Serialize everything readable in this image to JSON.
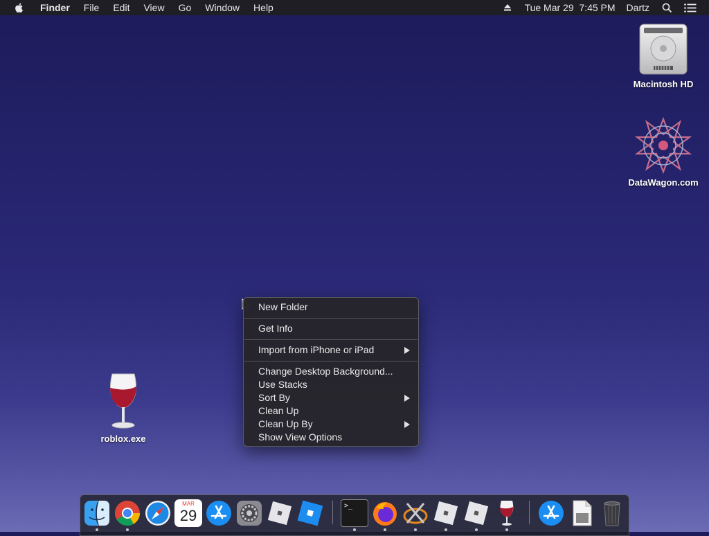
{
  "menubar": {
    "app": "Finder",
    "menus": [
      "File",
      "Edit",
      "View",
      "Go",
      "Window",
      "Help"
    ],
    "datetime": "Tue Mar 29  7:45 PM",
    "user": "Dartz"
  },
  "desktop": {
    "icons": [
      {
        "label": "Macintosh HD",
        "icon": "hard-drive-icon"
      },
      {
        "label": "DataWagon.com",
        "icon": "datawagon-icon"
      },
      {
        "label": "roblox.exe",
        "icon": "wine-glass-icon"
      }
    ]
  },
  "context_menu": {
    "items": [
      {
        "label": "New Folder"
      },
      {
        "label": "Get Info"
      },
      {
        "label": "Import from iPhone or iPad",
        "submenu": true
      },
      {
        "label": "Change Desktop Background..."
      },
      {
        "label": "Use Stacks"
      },
      {
        "label": "Sort By",
        "submenu": true
      },
      {
        "label": "Clean Up"
      },
      {
        "label": "Clean Up By",
        "submenu": true
      },
      {
        "label": "Show View Options"
      }
    ]
  },
  "dock": {
    "calendar_month": "MAR",
    "calendar_day": "29",
    "terminal_prompt": ">_",
    "apps": [
      "finder-icon",
      "chrome-icon",
      "safari-icon",
      "calendar-icon",
      "app-store-icon",
      "system-preferences-icon",
      "roblox-icon",
      "roblox-studio-icon",
      "terminal-icon",
      "firefox-icon",
      "xquartz-icon",
      "roblox-icon",
      "roblox-icon",
      "wine-icon",
      "app-store-icon",
      "document-icon",
      "trash-icon"
    ]
  },
  "colors": {
    "menubar": "#1f1e24",
    "menu_bg": "#26252a",
    "wallpaper_top": "#1d1b5a",
    "wallpaper_bottom": "#6b6cb4"
  }
}
